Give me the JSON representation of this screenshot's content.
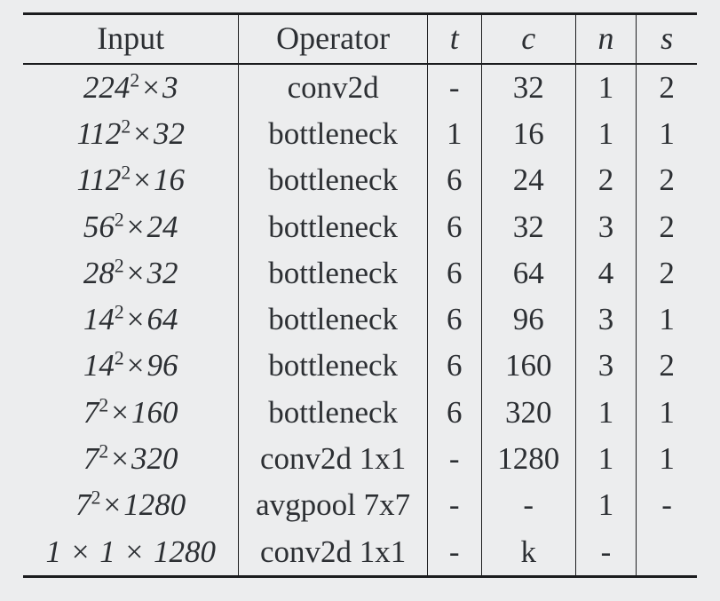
{
  "chart_data": {
    "type": "table",
    "headers": {
      "input": "Input",
      "operator": "Operator",
      "t": "t",
      "c": "c",
      "n": "n",
      "s": "s"
    },
    "rows": [
      {
        "input": {
          "base": "224",
          "exp": "2",
          "ch": "3"
        },
        "operator": "conv2d",
        "t": "-",
        "c": "32",
        "n": "1",
        "s": "2"
      },
      {
        "input": {
          "base": "112",
          "exp": "2",
          "ch": "32"
        },
        "operator": "bottleneck",
        "t": "1",
        "c": "16",
        "n": "1",
        "s": "1"
      },
      {
        "input": {
          "base": "112",
          "exp": "2",
          "ch": "16"
        },
        "operator": "bottleneck",
        "t": "6",
        "c": "24",
        "n": "2",
        "s": "2"
      },
      {
        "input": {
          "base": "56",
          "exp": "2",
          "ch": "24"
        },
        "operator": "bottleneck",
        "t": "6",
        "c": "32",
        "n": "3",
        "s": "2"
      },
      {
        "input": {
          "base": "28",
          "exp": "2",
          "ch": "32"
        },
        "operator": "bottleneck",
        "t": "6",
        "c": "64",
        "n": "4",
        "s": "2"
      },
      {
        "input": {
          "base": "14",
          "exp": "2",
          "ch": "64"
        },
        "operator": "bottleneck",
        "t": "6",
        "c": "96",
        "n": "3",
        "s": "1"
      },
      {
        "input": {
          "base": "14",
          "exp": "2",
          "ch": "96"
        },
        "operator": "bottleneck",
        "t": "6",
        "c": "160",
        "n": "3",
        "s": "2"
      },
      {
        "input": {
          "base": "7",
          "exp": "2",
          "ch": "160"
        },
        "operator": "bottleneck",
        "t": "6",
        "c": "320",
        "n": "1",
        "s": "1"
      },
      {
        "input": {
          "base": "7",
          "exp": "2",
          "ch": "320"
        },
        "operator": "conv2d 1x1",
        "t": "-",
        "c": "1280",
        "n": "1",
        "s": "1"
      },
      {
        "input": {
          "base": "7",
          "exp": "2",
          "ch": "1280"
        },
        "operator": "avgpool 7x7",
        "t": "-",
        "c": "-",
        "n": "1",
        "s": "-"
      },
      {
        "input": {
          "raw": "1 × 1 × 1280"
        },
        "operator": "conv2d 1x1",
        "t": "-",
        "c": "k",
        "n": "-",
        "s": ""
      }
    ]
  }
}
